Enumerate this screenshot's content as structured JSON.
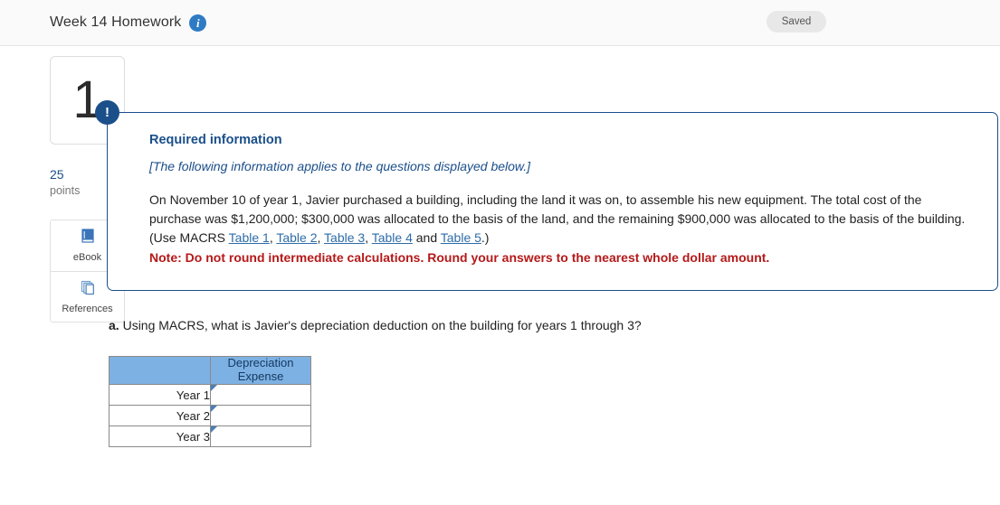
{
  "topbar": {
    "title": "Week 14 Homework",
    "info_icon": "info-icon",
    "status_badge": "Saved"
  },
  "rail": {
    "question_number": "1",
    "points_value": "25",
    "points_label": "points",
    "tools": [
      {
        "icon": "book-icon",
        "label": "eBook"
      },
      {
        "icon": "pages-icon",
        "label": "References"
      }
    ]
  },
  "callout": {
    "badge": "!",
    "title": "Required information",
    "applies_note": "[The following information applies to the questions displayed below.]",
    "body_part1": "On November 10 of year 1, Javier purchased a building, including the land it was on, to assemble his new equipment. The total cost of the purchase was $1,200,000; $300,000 was allocated to the basis of the land, and the remaining $900,000 was allocated to the basis of the building. (Use MACRS ",
    "links": [
      "Table 1",
      "Table 2",
      "Table 3",
      "Table 4",
      "Table 5"
    ],
    "link_sep": ", ",
    "link_and": " and ",
    "body_close": ".)",
    "note": "Note: Do not round intermediate calculations. Round your answers to the nearest whole dollar amount."
  },
  "question": {
    "label": "a.",
    "text": " Using MACRS, what is Javier's depreciation deduction on the building for years 1 through 3?"
  },
  "answer_table": {
    "header_blank": "",
    "header_col2_line1": "Depreciation",
    "header_col2_line2": "Expense",
    "rows": [
      {
        "label": "Year 1",
        "value": ""
      },
      {
        "label": "Year 2",
        "value": ""
      },
      {
        "label": "Year 3",
        "value": ""
      }
    ]
  },
  "colors": {
    "brand_navy": "#1b4f8a",
    "header_blue": "#7eb1e3",
    "input_border": "#4a7fb5",
    "note_red": "#b51919",
    "link_blue": "#2e6ca8"
  }
}
